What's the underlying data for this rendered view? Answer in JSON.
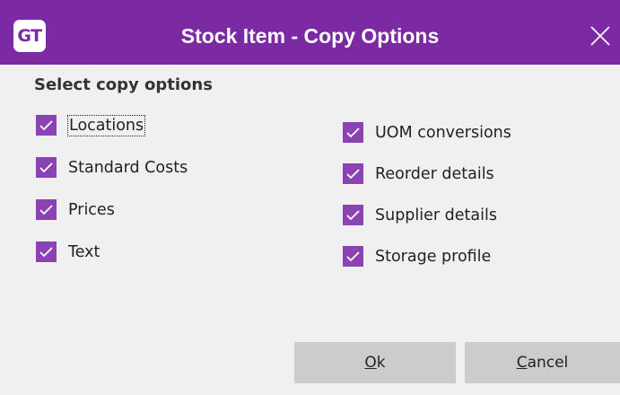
{
  "dialog": {
    "logo_text": "GT",
    "title": "Stock Item - Copy Options",
    "close_icon": "close-icon",
    "section_label": "Select copy options",
    "accent_color": "#7b2aa3",
    "checkbox_color": "#8b43b3"
  },
  "options_left": [
    {
      "label": "Locations",
      "checked": true
    },
    {
      "label": "Standard Costs",
      "checked": true
    },
    {
      "label": "Prices",
      "checked": true
    },
    {
      "label": "Text",
      "checked": true
    }
  ],
  "options_right": [
    {
      "label": "UOM conversions",
      "checked": true
    },
    {
      "label": "Reorder details",
      "checked": true
    },
    {
      "label": "Supplier details",
      "checked": true
    },
    {
      "label": "Storage profile",
      "checked": true
    }
  ],
  "buttons": {
    "ok_accel": "O",
    "ok_rest": "k",
    "cancel_accel": "C",
    "cancel_rest": "ancel"
  }
}
